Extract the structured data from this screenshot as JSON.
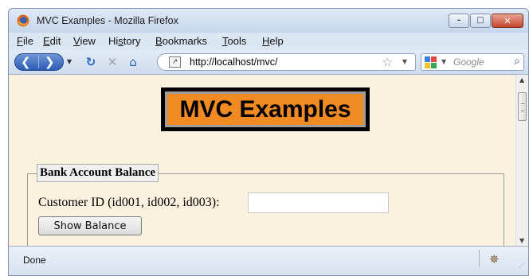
{
  "window": {
    "title": "MVC Examples - Mozilla Firefox"
  },
  "window_controls": {
    "minimize": "–",
    "maximize": "□",
    "close": "✕"
  },
  "menu": [
    {
      "pre": "",
      "accel": "F",
      "post": "ile"
    },
    {
      "pre": "",
      "accel": "E",
      "post": "dit"
    },
    {
      "pre": "",
      "accel": "V",
      "post": "iew"
    },
    {
      "pre": "Hi",
      "accel": "s",
      "post": "tory"
    },
    {
      "pre": "",
      "accel": "B",
      "post": "ookmarks"
    },
    {
      "pre": "",
      "accel": "T",
      "post": "ools"
    },
    {
      "pre": "",
      "accel": "H",
      "post": "elp"
    }
  ],
  "nav": {
    "url": "http://localhost/mvc/",
    "search_placeholder": "Google"
  },
  "page": {
    "heading": "MVC Examples",
    "form": {
      "legend": "Bank Account Balance",
      "customer_label": "Customer ID (id001, id002, id003):",
      "customer_value": "",
      "button_label": "Show Balance"
    }
  },
  "status": {
    "text": "Done"
  },
  "colors": {
    "banner_bg": "#f08a23",
    "page_bg": "#fbf1df"
  }
}
